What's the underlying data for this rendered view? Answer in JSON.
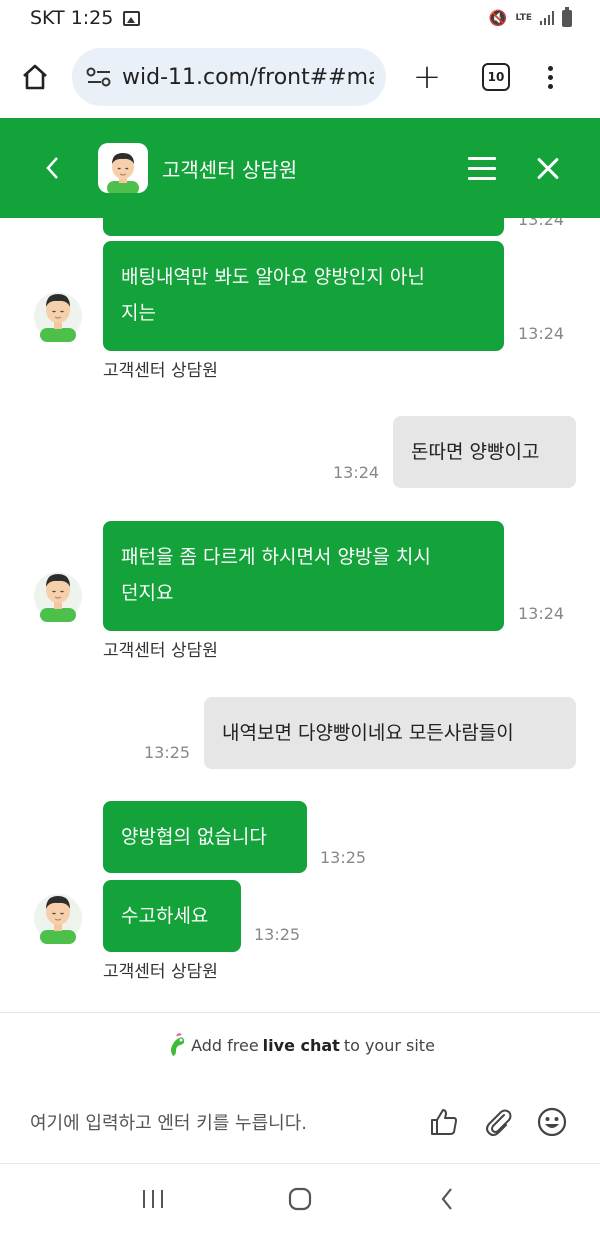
{
  "status": {
    "carrier_time": "SKT 1:25",
    "lte": "LTE"
  },
  "browser": {
    "url": "wid-11.com/front##ma",
    "tab_count": "10"
  },
  "header": {
    "title": "고객센터 상담원",
    "brand_color": "#14a23a"
  },
  "messages": [
    {
      "from": "agent",
      "text": "",
      "time": "13:24"
    },
    {
      "from": "agent",
      "text_line1": "배팅내역만 봐도 알아요 양방인지 아닌",
      "text_line2": "지는",
      "time": "13:24",
      "sender": "고객센터 상담원"
    },
    {
      "from": "user",
      "text": "돈따면 양빵이고",
      "time": "13:24"
    },
    {
      "from": "agent",
      "text_line1": "패턴을 좀 다르게 하시면서 양방을 치시",
      "text_line2": "던지요",
      "time": "13:24",
      "sender": "고객센터 상담원"
    },
    {
      "from": "user",
      "text": "내역보면 다양빵이네요 모든사람들이",
      "time": "13:25"
    },
    {
      "from": "agent",
      "text": "양방협의 없습니다",
      "time": "13:25"
    },
    {
      "from": "agent",
      "text": "수고하세요",
      "time": "13:25",
      "sender": "고객센터 상담원"
    }
  ],
  "footer": {
    "branding_prefix": "Add free",
    "branding_bold": "live chat",
    "branding_suffix": "to your site",
    "input_placeholder": "여기에 입력하고 엔터 키를 누릅니다."
  }
}
